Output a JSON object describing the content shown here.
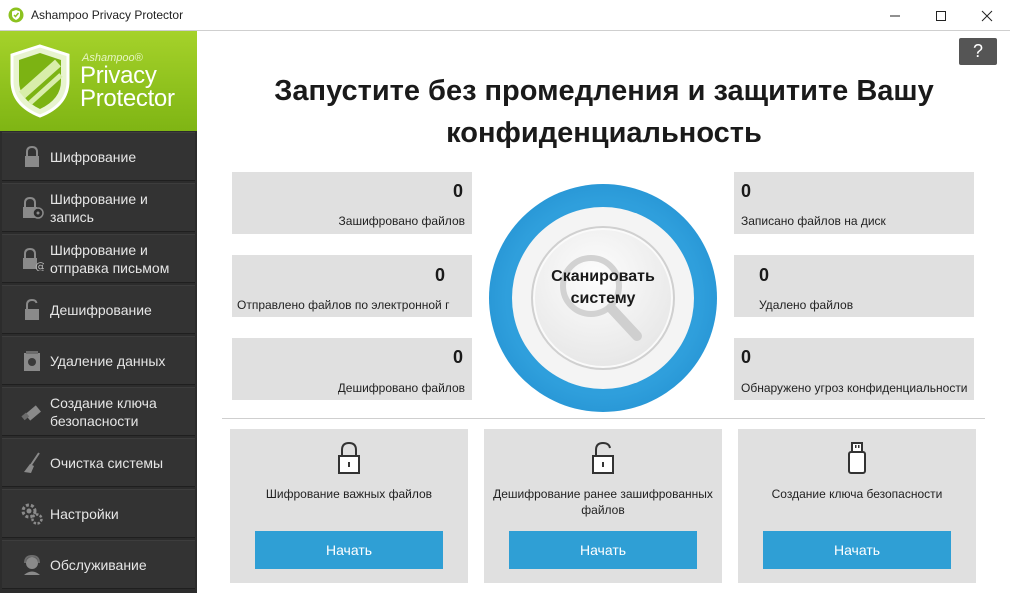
{
  "window": {
    "title": "Ashampoo Privacy Protector",
    "controls": {
      "minimize": "minimize-icon",
      "maximize": "maximize-icon",
      "close": "close-icon"
    }
  },
  "brand": {
    "small": "Ashampoo®",
    "line1": "Privacy",
    "line2": "Protector"
  },
  "sidebar": {
    "items": [
      {
        "label": "Шифрование",
        "icon": "lock-icon"
      },
      {
        "label": "Шифрование и запись",
        "icon": "lock-disc-icon"
      },
      {
        "label": "Шифрование и отправка письмом",
        "icon": "lock-mail-icon"
      },
      {
        "label": "Дешифрование",
        "icon": "unlock-icon"
      },
      {
        "label": "Удаление данных",
        "icon": "shredder-icon"
      },
      {
        "label": "Создание ключа безопасности",
        "icon": "usb-key-icon"
      },
      {
        "label": "Очистка системы",
        "icon": "broom-icon"
      },
      {
        "label": "Настройки",
        "icon": "gears-icon"
      },
      {
        "label": "Обслуживание",
        "icon": "support-icon"
      }
    ]
  },
  "help": {
    "label": "?"
  },
  "main": {
    "headline_line1": "Запустите без промедления и защитите Вашу",
    "headline_line2": "конфиденциальность",
    "scan_label": "Сканировать систему",
    "stats": [
      {
        "value": "0",
        "label": "Зашифровано файлов"
      },
      {
        "value": "0",
        "label": "Отправлено файлов по электронной г"
      },
      {
        "value": "0",
        "label": "Дешифровано файлов"
      },
      {
        "value": "0",
        "label": "Записано файлов на диск"
      },
      {
        "value": "0",
        "label": "Удалено файлов"
      },
      {
        "value": "0",
        "label": "Обнаружено угроз конфиденциальности"
      }
    ],
    "cards": [
      {
        "text": "Шифрование важных файлов",
        "button": "Начать",
        "icon": "lock-icon"
      },
      {
        "text": "Дешифрование ранее зашифрованных файлов",
        "button": "Начать",
        "icon": "unlock-icon"
      },
      {
        "text": "Создание ключа безопасности",
        "button": "Начать",
        "icon": "usb-key-icon"
      }
    ]
  },
  "colors": {
    "accent": "#2f9fd5",
    "brand_green": "#8cc21f",
    "sidebar": "#2c2c2c",
    "panel": "#e0e0e0"
  }
}
